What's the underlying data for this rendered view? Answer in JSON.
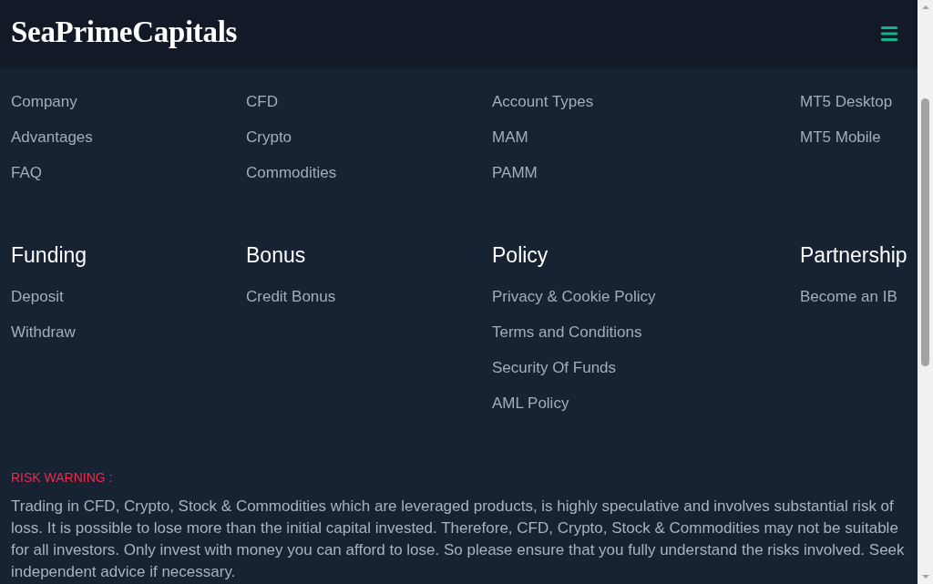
{
  "header": {
    "logo": "SeaPrimeCapitals"
  },
  "link_columns": [
    {
      "links": [
        "Company",
        "Advantages",
        "FAQ"
      ]
    },
    {
      "links": [
        "CFD",
        "Crypto",
        "Commodities"
      ]
    },
    {
      "links": [
        "Account Types",
        "MAM",
        "PAMM"
      ]
    },
    {
      "links": [
        "MT5 Desktop",
        "MT5 Mobile"
      ]
    }
  ],
  "sections": [
    {
      "heading": "Funding",
      "links": [
        "Deposit",
        "Withdraw"
      ]
    },
    {
      "heading": "Bonus",
      "links": [
        "Credit Bonus"
      ]
    },
    {
      "heading": "Policy",
      "links": [
        "Privacy & Cookie Policy",
        "Terms and Conditions",
        "Security Of Funds",
        "AML Policy"
      ]
    },
    {
      "heading": "Partnership",
      "links": [
        "Become an IB"
      ]
    }
  ],
  "risk_warning": {
    "title": "RISK WARNING :",
    "text": "Trading in CFD, Crypto, Stock & Commodities which are leveraged products, is highly speculative and involves substantial risk of loss. It is possible to lose more than the initial capital invested. Therefore, CFD, Crypto, Stock & Commodities may not be suitable for all investors. Only invest with money you can afford to lose. So please ensure that you fully understand the risks involved. Seek independent advice if necessary."
  }
}
